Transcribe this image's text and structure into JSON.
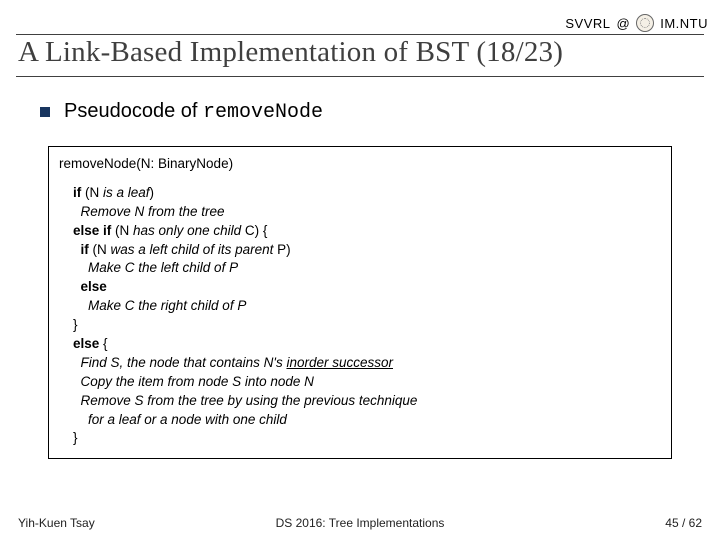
{
  "header": {
    "left_label": "SVVRL",
    "at": "@",
    "right_label": "IM.NTU"
  },
  "title": "A Link-Based Implementation of BST (18/23)",
  "section": {
    "prefix": "Pseudocode of ",
    "code_name": "removeNode"
  },
  "code": {
    "signature": "removeNode(N: BinaryNode)",
    "lines": [
      {
        "segments": [
          {
            "t": "if",
            "cls": "kw"
          },
          {
            "t": " (N "
          },
          {
            "t": "is a leaf",
            "cls": "it"
          },
          {
            "t": ")"
          }
        ]
      },
      {
        "segments": [
          {
            "t": "  Remove N from the tree",
            "cls": "it"
          }
        ]
      },
      {
        "segments": [
          {
            "t": "else if",
            "cls": "kw"
          },
          {
            "t": " (N "
          },
          {
            "t": "has only one child",
            "cls": "it"
          },
          {
            "t": " C) {"
          }
        ]
      },
      {
        "segments": [
          {
            "t": "  "
          },
          {
            "t": "if",
            "cls": "kw"
          },
          {
            "t": " (N "
          },
          {
            "t": "was a left child of its parent",
            "cls": "it"
          },
          {
            "t": " P)"
          }
        ]
      },
      {
        "segments": [
          {
            "t": "    Make C the left child of P",
            "cls": "it"
          }
        ]
      },
      {
        "segments": [
          {
            "t": "  "
          },
          {
            "t": "else",
            "cls": "kw"
          }
        ]
      },
      {
        "segments": [
          {
            "t": "    Make C the right child of P",
            "cls": "it"
          }
        ]
      },
      {
        "segments": [
          {
            "t": "}"
          }
        ]
      },
      {
        "segments": [
          {
            "t": "else",
            "cls": "kw"
          },
          {
            "t": " {"
          }
        ]
      },
      {
        "segments": [
          {
            "t": "  Find S, the node that contains N's ",
            "cls": "it"
          },
          {
            "t": "inorder successor",
            "cls": "it us"
          }
        ]
      },
      {
        "segments": [
          {
            "t": "  Copy the item from node S into node N",
            "cls": "it"
          }
        ]
      },
      {
        "segments": [
          {
            "t": "  Remove S from the tree by using the previous technique",
            "cls": "it"
          }
        ]
      },
      {
        "segments": [
          {
            "t": "    for a leaf or a node with one child",
            "cls": "it"
          }
        ]
      },
      {
        "segments": [
          {
            "t": "}"
          }
        ]
      }
    ]
  },
  "footer": {
    "left": "Yih-Kuen Tsay",
    "center": "DS 2016: Tree Implementations",
    "right": "45 / 62"
  }
}
